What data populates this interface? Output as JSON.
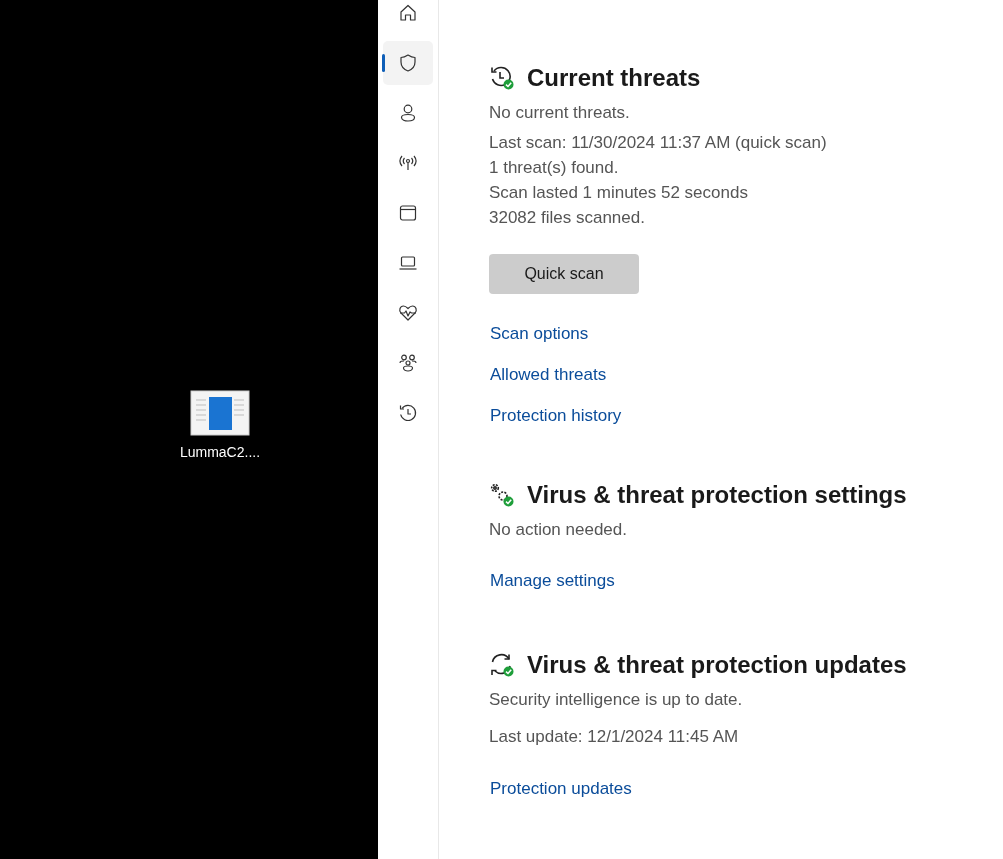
{
  "desktop": {
    "icons": [
      {
        "label": "LummaC2...."
      }
    ]
  },
  "nav": {
    "items": [
      {
        "kind": "home",
        "selected": false
      },
      {
        "kind": "shield",
        "selected": true
      },
      {
        "kind": "person",
        "selected": false
      },
      {
        "kind": "antenna",
        "selected": false
      },
      {
        "kind": "window",
        "selected": false
      },
      {
        "kind": "laptop",
        "selected": false
      },
      {
        "kind": "heart",
        "selected": false
      },
      {
        "kind": "family",
        "selected": false
      },
      {
        "kind": "history",
        "selected": false
      }
    ]
  },
  "sections": [
    {
      "kind": "threats",
      "title": "Current threats",
      "status": "No current threats.",
      "details": [
        "Last scan: 11/30/2024 11:37 AM (quick scan)",
        "1 threat(s) found.",
        "Scan lasted 1 minutes 52 seconds",
        "32082 files scanned."
      ],
      "button": "Quick scan",
      "links": [
        "Scan options",
        "Allowed threats",
        "Protection history"
      ]
    },
    {
      "kind": "settings",
      "title": "Virus & threat protection settings",
      "status": "No action needed.",
      "links": [
        "Manage settings"
      ]
    },
    {
      "kind": "updates",
      "title": "Virus & threat protection updates",
      "status": "Security intelligence is up to date.",
      "details": [
        "Last update: 12/1/2024 11:45 AM"
      ],
      "links": [
        "Protection updates"
      ]
    }
  ]
}
